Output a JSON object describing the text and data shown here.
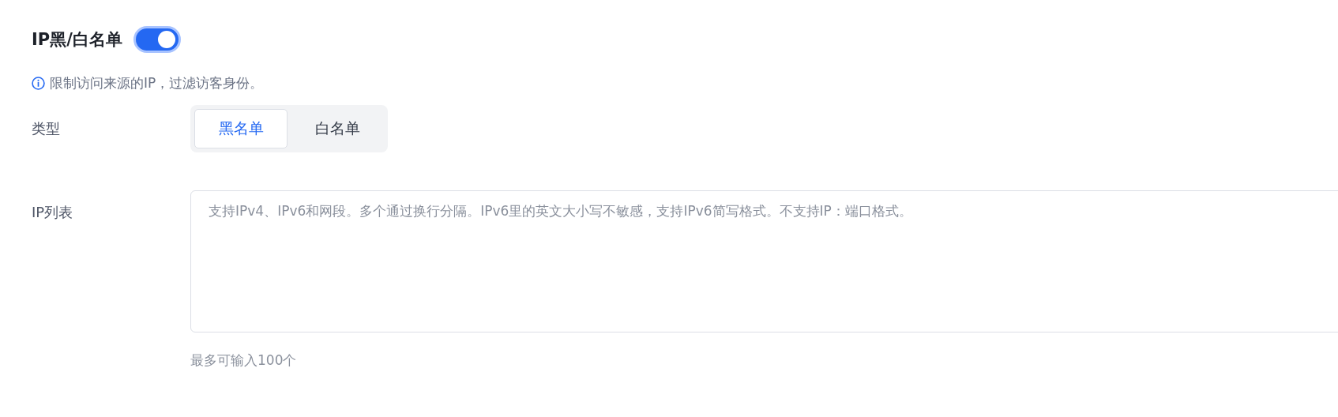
{
  "section": {
    "title": "IP黑/白名单",
    "enabled": true,
    "hint": "限制访问来源的IP，过滤访客身份。"
  },
  "type_field": {
    "label": "类型",
    "options": [
      {
        "label": "黑名单",
        "selected": true
      },
      {
        "label": "白名单",
        "selected": false
      }
    ]
  },
  "ip_list": {
    "label": "IP列表",
    "placeholder": "支持IPv4、IPv6和网段。多个通过换行分隔。IPv6里的英文大小写不敏感，支持IPv6简写格式。不支持IP：端口格式。",
    "helper": "最多可输入100个"
  }
}
